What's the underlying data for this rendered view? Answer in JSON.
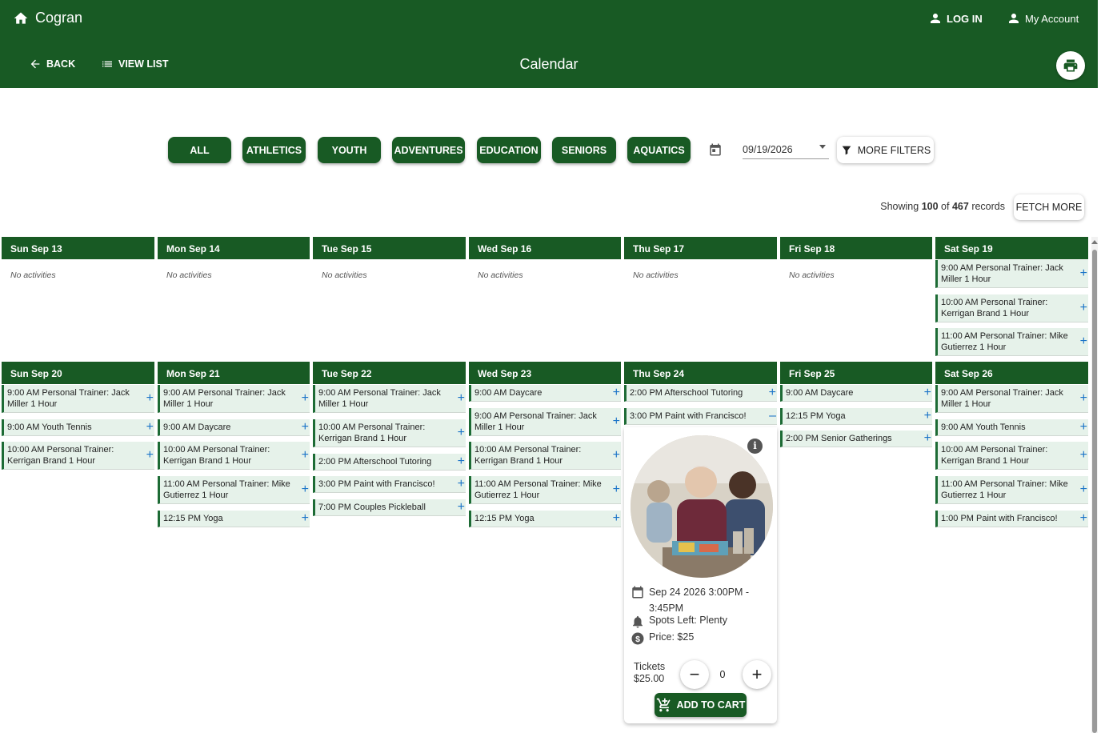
{
  "header": {
    "brand": "Cogran",
    "login_label": "LOG IN",
    "account_label": "My Account",
    "back_label": "BACK",
    "viewlist_label": "VIEW LIST",
    "title": "Calendar"
  },
  "filters": {
    "chips": [
      "ALL",
      "ATHLETICS",
      "YOUTH",
      "ADVENTURES",
      "EDUCATION",
      "SENIORS",
      "AQUATICS"
    ],
    "date_value": "09/19/2026",
    "more_filters_label": "MORE FILTERS"
  },
  "records": {
    "showing_prefix": "Showing",
    "shown": "100",
    "of_word": "of",
    "total": "467",
    "records_word": "records",
    "fetch_more_label": "FETCH MORE"
  },
  "no_activities_text": "No activities",
  "week1": {
    "days": [
      {
        "label": "Sun Sep 13",
        "events": []
      },
      {
        "label": "Mon Sep 14",
        "events": []
      },
      {
        "label": "Tue Sep 15",
        "events": []
      },
      {
        "label": "Wed Sep 16",
        "events": []
      },
      {
        "label": "Thu Sep 17",
        "events": []
      },
      {
        "label": "Fri Sep 18",
        "events": []
      },
      {
        "label": "Sat Sep 19",
        "events": [
          "9:00 AM Personal Trainer: Jack Miller 1 Hour",
          "10:00 AM Personal Trainer: Kerrigan Brand 1 Hour",
          "11:00 AM Personal Trainer: Mike Gutierrez 1 Hour"
        ]
      }
    ]
  },
  "week2": {
    "days": [
      {
        "label": "Sun Sep 20",
        "events": [
          "9:00 AM Personal Trainer: Jack Miller 1 Hour",
          "9:00 AM Youth Tennis",
          "10:00 AM Personal Trainer: Kerrigan Brand 1 Hour"
        ]
      },
      {
        "label": "Mon Sep 21",
        "events": [
          "9:00 AM Personal Trainer: Jack Miller 1 Hour",
          "9:00 AM Daycare",
          "10:00 AM Personal Trainer: Kerrigan Brand 1 Hour",
          "11:00 AM Personal Trainer: Mike Gutierrez 1 Hour",
          "12:15 PM Yoga"
        ]
      },
      {
        "label": "Tue Sep 22",
        "events": [
          "9:00 AM Personal Trainer: Jack Miller 1 Hour",
          "10:00 AM Personal Trainer: Kerrigan Brand 1 Hour",
          "2:00 PM Afterschool Tutoring",
          "3:00 PM Paint with Francisco!",
          "7:00 PM Couples Pickleball"
        ]
      },
      {
        "label": "Wed Sep 23",
        "events": [
          "9:00 AM Daycare",
          "9:00 AM Personal Trainer: Jack Miller 1 Hour",
          "10:00 AM Personal Trainer: Kerrigan Brand 1 Hour",
          "11:00 AM Personal Trainer: Mike Gutierrez 1 Hour",
          "12:15 PM Yoga"
        ]
      },
      {
        "label": "Thu Sep 24",
        "events": [
          "2:00 PM Afterschool Tutoring",
          "3:00 PM Paint with Francisco!"
        ]
      },
      {
        "label": "Fri Sep 25",
        "events": [
          "9:00 AM Daycare",
          "12:15 PM Yoga",
          "2:00 PM Senior Gatherings"
        ]
      },
      {
        "label": "Sat Sep 26",
        "events": [
          "9:00 AM Personal Trainer: Jack Miller 1 Hour",
          "9:00 AM Youth Tennis",
          "10:00 AM Personal Trainer: Kerrigan Brand 1 Hour",
          "11:00 AM Personal Trainer: Mike Gutierrez 1 Hour",
          "1:00 PM Paint with Francisco!"
        ]
      }
    ]
  },
  "popup": {
    "datetime": "Sep 24 2026 3:00PM - 3:45PM",
    "spots": "Spots Left: Plenty",
    "price": "Price: $25",
    "tickets_label": "Tickets",
    "tickets_price": "$25.00",
    "quantity": "0",
    "add_to_cart_label": "ADD TO CART"
  },
  "colors": {
    "brand_green": "#185a24",
    "event_bg": "#e6f2ea",
    "plus_blue": "#1a73c8"
  }
}
